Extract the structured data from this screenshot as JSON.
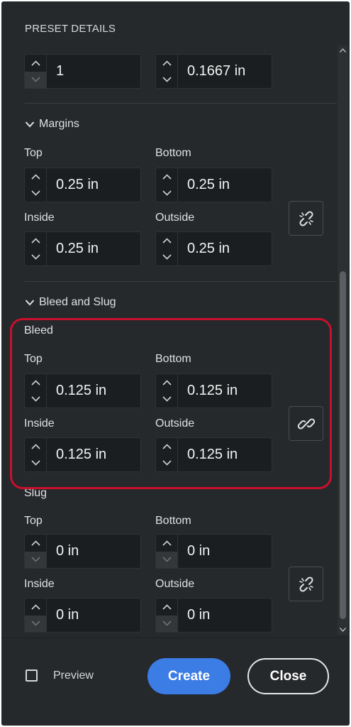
{
  "preset": {
    "title": "PRESET DETAILS",
    "columns_value": "1",
    "gutter_value": "0.1667 in"
  },
  "margins": {
    "heading": "Margins",
    "top_label": "Top",
    "top_value": "0.25 in",
    "bottom_label": "Bottom",
    "bottom_value": "0.25 in",
    "inside_label": "Inside",
    "inside_value": "0.25 in",
    "outside_label": "Outside",
    "outside_value": "0.25 in",
    "link_icon": "broken-link-icon"
  },
  "bleed_slug": {
    "heading": "Bleed and Slug",
    "bleed": {
      "label": "Bleed",
      "top_label": "Top",
      "top_value": "0.125 in",
      "bottom_label": "Bottom",
      "bottom_value": "0.125 in",
      "inside_label": "Inside",
      "inside_value": "0.125 in",
      "outside_label": "Outside",
      "outside_value": "0.125 in",
      "link_icon": "link-icon"
    },
    "slug": {
      "label": "Slug",
      "top_label": "Top",
      "top_value": "0 in",
      "bottom_label": "Bottom",
      "bottom_value": "0 in",
      "inside_label": "Inside",
      "inside_value": "0 in",
      "outside_label": "Outside",
      "outside_value": "0 in",
      "link_icon": "broken-link-icon"
    }
  },
  "footer": {
    "preview_label": "Preview",
    "preview_checked": false,
    "create_label": "Create",
    "close_label": "Close"
  },
  "colors": {
    "panel_bg": "#25292c",
    "field_bg": "#1b1e20",
    "accent": "#3b7ce5",
    "highlight": "#c8102e"
  }
}
